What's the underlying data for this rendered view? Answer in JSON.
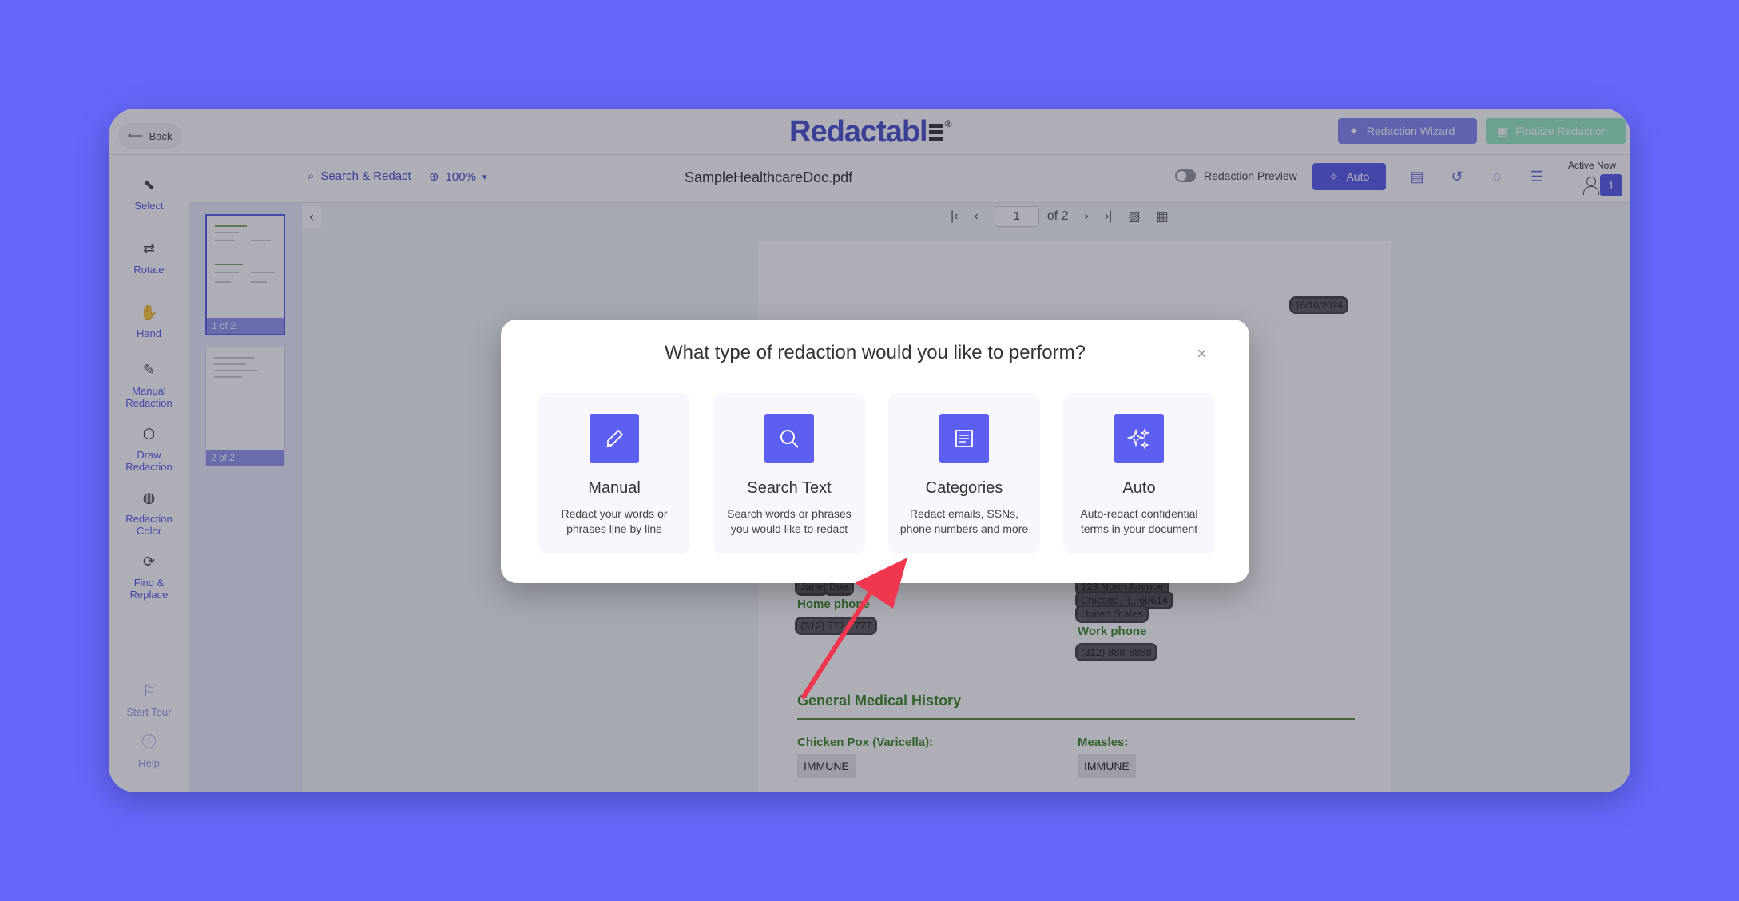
{
  "app": {
    "back_label": "Back",
    "logo_text": "Redactabl",
    "logo_reg": "®"
  },
  "header": {
    "wizard_label": "Redaction Wizard",
    "finalize_label": "Finalize Redaction"
  },
  "toolbar": {
    "search_label": "Search & Redact",
    "zoom_label": "100%",
    "filename": "SampleHealthcareDoc.pdf",
    "preview_label": "Redaction Preview",
    "auto_label": "Auto",
    "active_now_label": "Active Now",
    "active_count": "1"
  },
  "tools": [
    {
      "label": "Select",
      "icon": "select-icon"
    },
    {
      "label": "Rotate",
      "icon": "rotate-icon"
    },
    {
      "label": "Hand",
      "icon": "hand-icon"
    },
    {
      "label": "Manual Redaction",
      "icon": "pen-icon"
    },
    {
      "label": "Draw Redaction",
      "icon": "cube-icon"
    },
    {
      "label": "Redaction Color",
      "icon": "palette-icon"
    },
    {
      "label": "Find & Replace",
      "icon": "find-replace-icon"
    },
    {
      "label": "Start Tour",
      "icon": "flag-icon"
    },
    {
      "label": "Help",
      "icon": "info-icon"
    }
  ],
  "thumbnails": [
    {
      "label": "1 of 2"
    },
    {
      "label": "2 of 2"
    }
  ],
  "pager": {
    "current_page": "1",
    "of_label": "of 2"
  },
  "document": {
    "date": "16/10/2024",
    "name_first": "Jane",
    "name_last": "Doe",
    "address_line1": "123 North Avenue",
    "address_line2": "Chicago, IL, 60614",
    "address_line3": "United States",
    "home_phone_label": "Home phone",
    "home_phone": "(312) 777-7777",
    "work_phone_label": "Work phone",
    "work_phone": "(312) 888-8888",
    "section_title": "General Medical History",
    "field1_label": "Chicken Pox (Varicella):",
    "field1_value": "IMMUNE",
    "field2_label": "Measles:",
    "field2_value": "IMMUNE"
  },
  "modal": {
    "title": "What type of redaction would you like to perform?",
    "close_symbol": "×",
    "options": [
      {
        "title": "Manual",
        "desc": "Redact your words or phrases line by line",
        "icon": "pen-icon"
      },
      {
        "title": "Search Text",
        "desc": "Search words or phrases you would like to redact",
        "icon": "search-icon"
      },
      {
        "title": "Categories",
        "desc": "Redact emails, SSNs, phone numbers and more",
        "icon": "document-list-icon"
      },
      {
        "title": "Auto",
        "desc": "Auto-redact confidential terms in your document",
        "icon": "sparkles-icon"
      }
    ]
  },
  "colors": {
    "background": "#6567fb",
    "accent": "#4b4dea",
    "arrow": "#f0374f",
    "section_green": "#2f7d12"
  }
}
